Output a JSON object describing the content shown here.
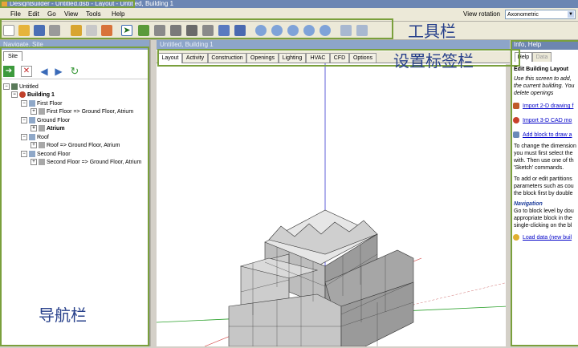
{
  "window": {
    "title": "DesignBuilder - Untitled.dsb - Layout - Untitled, Building 1"
  },
  "menu": {
    "items": [
      "File",
      "Edit",
      "Go",
      "View",
      "Tools",
      "Help"
    ]
  },
  "view_rotation": {
    "label": "View rotation",
    "value": "Axonometric"
  },
  "toolbar": {
    "icons": [
      "new-file-icon",
      "open-folder-icon",
      "save-icon",
      "print-icon",
      "wrench-icon",
      "eraser-icon",
      "import-icon",
      "select-arrow-icon",
      "move-icon",
      "copy-block-icon",
      "block-icon",
      "stretch-icon",
      "rotate-icon",
      "paintbrush-icon",
      "pencil-icon",
      "zoom-icon",
      "zoom-in-icon",
      "zoom-out-icon",
      "zoom-extents-icon",
      "zoom-previous-icon",
      "image-icon",
      "camera-icon"
    ]
  },
  "navigate": {
    "header": "Navigate, Site",
    "tab": "Site",
    "tree": {
      "root": "Untitled",
      "building": "Building 1",
      "items": [
        {
          "label": "First Floor",
          "level": 2
        },
        {
          "label": "First Floor => Ground Floor, Atrium",
          "level": 3
        },
        {
          "label": "Ground Floor",
          "level": 2
        },
        {
          "label": "Atrium",
          "level": 3
        },
        {
          "label": "Roof",
          "level": 2
        },
        {
          "label": "Roof => Ground Floor, Atrium",
          "level": 3
        },
        {
          "label": "Second Floor",
          "level": 2
        },
        {
          "label": "Second Floor => Ground Floor, Atrium",
          "level": 3
        }
      ]
    }
  },
  "main": {
    "header": "Untitled, Building 1",
    "tabs": [
      "Layout",
      "Activity",
      "Construction",
      "Openings",
      "Lighting",
      "HVAC",
      "CFD",
      "Options"
    ],
    "active_tab": "Layout"
  },
  "info": {
    "header": "Info, Help",
    "tabs": [
      "Help",
      "Data"
    ],
    "title": "Edit Building Layout",
    "lines": [
      {
        "text": "Use this screen to add,",
        "style": "it"
      },
      {
        "text": "the current building. You",
        "style": "it"
      },
      {
        "text": "delete openings",
        "style": "it"
      },
      {
        "text": "Import 2-D drawing f",
        "style": "lk"
      },
      {
        "text": "Import 3-D CAD mo",
        "style": "lk"
      },
      {
        "text": "Add block to draw a",
        "style": "lk"
      },
      {
        "text": "To change the dimension",
        "style": ""
      },
      {
        "text": "you must first select the",
        "style": ""
      },
      {
        "text": "with. Then use one of th",
        "style": ""
      },
      {
        "text": "'Sketch' commands.",
        "style": ""
      },
      {
        "text": "To add or edit partitions",
        "style": ""
      },
      {
        "text": "parameters such as cou",
        "style": ""
      },
      {
        "text": "the block first by double",
        "style": ""
      },
      {
        "text": "Navigation",
        "style": "hd"
      },
      {
        "text": "Go to block level by dou",
        "style": ""
      },
      {
        "text": "appropriate block in the",
        "style": ""
      },
      {
        "text": "single-clicking on the bl",
        "style": ""
      },
      {
        "text": "Load data (new buil",
        "style": "lk"
      }
    ]
  },
  "annotations": {
    "toolbar_label": "工具栏",
    "tabs_label": "设置标签栏",
    "nav_label": "导航栏"
  },
  "colors": {
    "annotation_border": "#7aa03c",
    "annotation_text": "#27408b",
    "panel_header": "#8da5c9"
  }
}
